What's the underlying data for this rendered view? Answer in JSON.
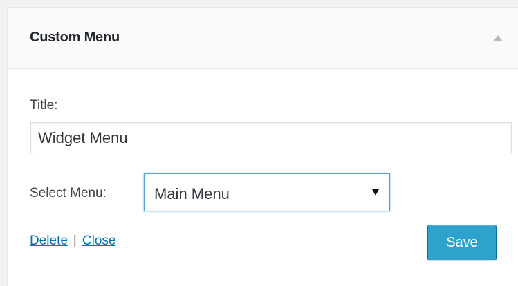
{
  "widget": {
    "title": "Custom Menu"
  },
  "form": {
    "title_label": "Title:",
    "title_value": "Widget Menu",
    "select_label": "Select Menu:",
    "select_value": "Main Menu",
    "delete_link": "Delete",
    "separator": "|",
    "close_link": "Close",
    "save_label": "Save"
  },
  "colors": {
    "accent": "#2ea2cc",
    "link": "#0073aa",
    "focus_border": "#5b9dd9"
  },
  "icons": {
    "toggle": "triangle-up-icon",
    "select_arrow": "triangle-down-icon"
  }
}
